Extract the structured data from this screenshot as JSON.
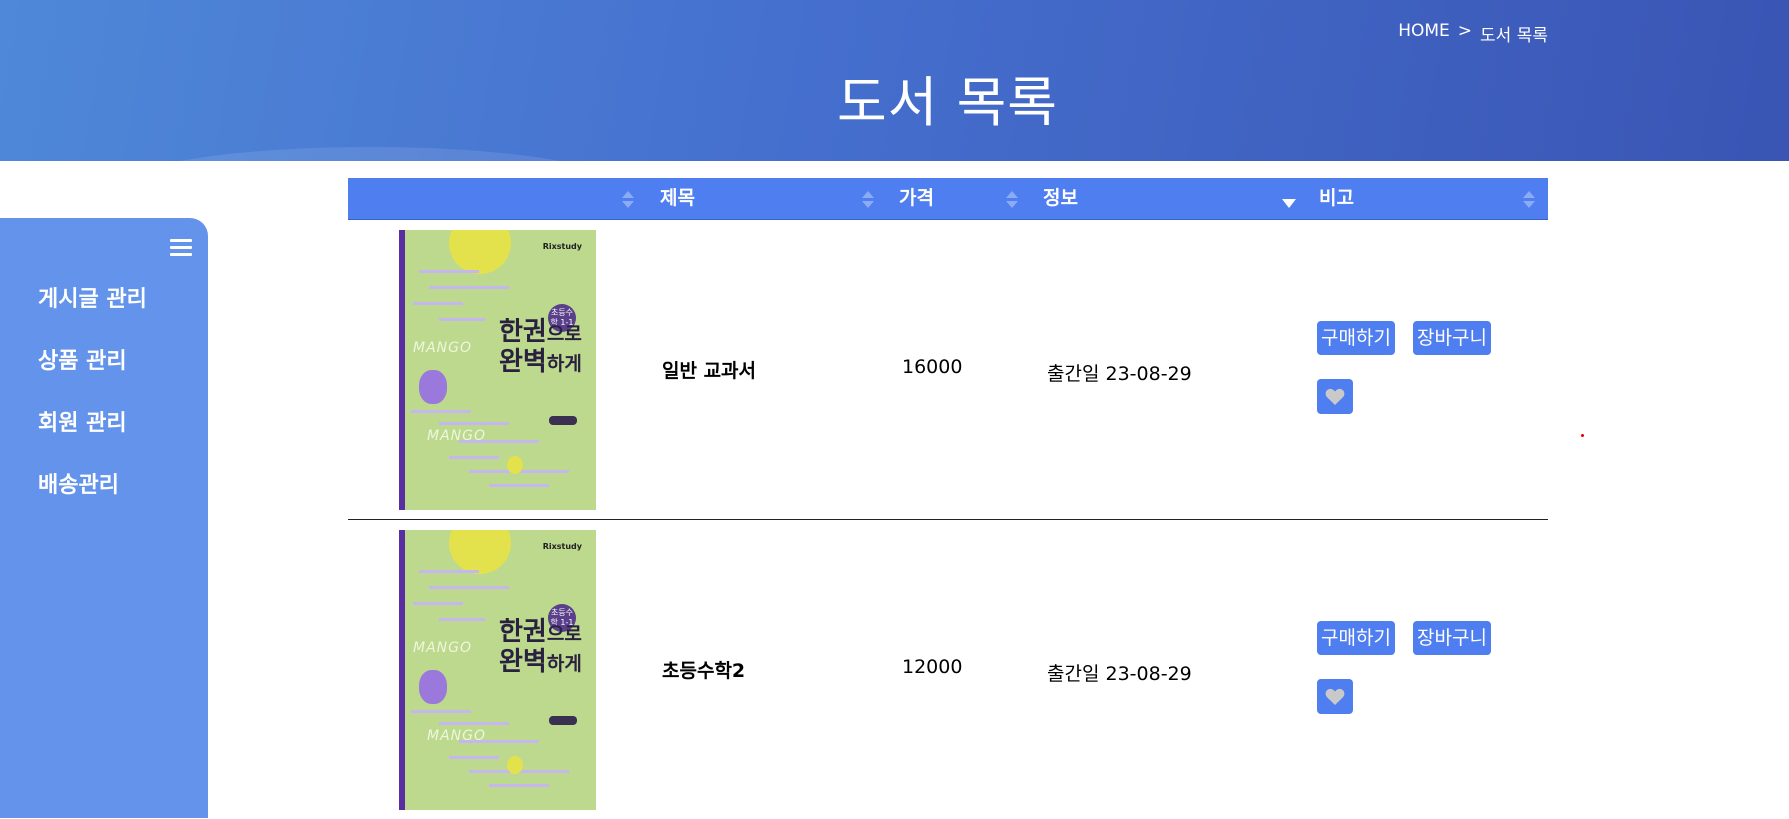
{
  "header": {
    "breadcrumb": {
      "home": "HOME",
      "separator": ">",
      "current": "도서 목록"
    },
    "title": "도서 목록"
  },
  "sidebar": {
    "menu_icon": "hamburger-icon",
    "items": [
      {
        "label": "게시글 관리"
      },
      {
        "label": "상품 관리"
      },
      {
        "label": "회원 관리"
      },
      {
        "label": "배송관리"
      }
    ]
  },
  "table": {
    "columns": [
      {
        "label": ""
      },
      {
        "label": "제목"
      },
      {
        "label": "가격"
      },
      {
        "label": "정보",
        "sort": "descending"
      },
      {
        "label": "비고"
      }
    ],
    "rows": [
      {
        "cover": {
          "brand": "Rixstudy",
          "badge": "초등수학 1-1",
          "title_a": "한권",
          "title_b": "으로",
          "title_c": "완벽",
          "title_d": "하게",
          "mango": "MANGO"
        },
        "title": "일반 교과서",
        "price": "16000",
        "info": "출간일 23-08-29",
        "buy_label": "구매하기",
        "cart_label": "장바구니",
        "like_icon": "heart-icon"
      },
      {
        "cover": {
          "brand": "Rixstudy",
          "badge": "초등수학 1-1",
          "title_a": "한권",
          "title_b": "으로",
          "title_c": "완벽",
          "title_d": "하게",
          "mango": "MANGO"
        },
        "title": "초등수학2",
        "price": "12000",
        "info": "출간일 23-08-29",
        "buy_label": "구매하기",
        "cart_label": "장바구니",
        "like_icon": "heart-icon"
      }
    ]
  },
  "colors": {
    "header_gradient_start": "#4f88d8",
    "header_gradient_end": "#3a55b4",
    "sidebar": "#6393ea",
    "table_header": "#4f7ef0",
    "button": "#4f7ef0"
  }
}
